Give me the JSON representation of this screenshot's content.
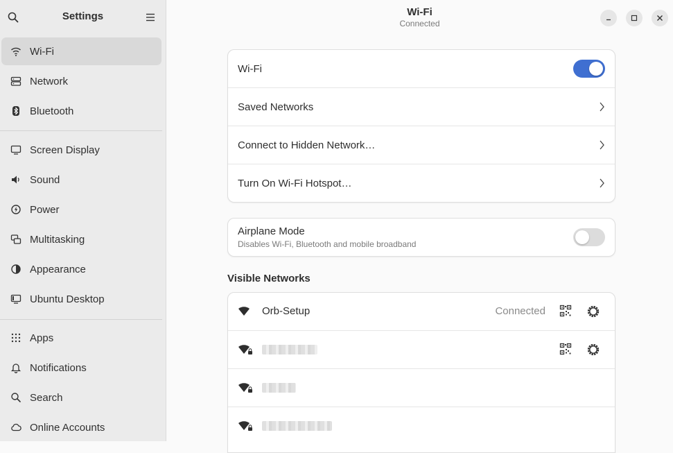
{
  "sidebar": {
    "title": "Settings",
    "items": [
      {
        "label": "Wi-Fi",
        "icon": "wifi-icon",
        "active": true
      },
      {
        "label": "Network",
        "icon": "network-icon"
      },
      {
        "label": "Bluetooth",
        "icon": "bluetooth-icon"
      },
      {
        "label": "Screen Display",
        "icon": "display-icon"
      },
      {
        "label": "Sound",
        "icon": "speaker-icon"
      },
      {
        "label": "Power",
        "icon": "power-icon"
      },
      {
        "label": "Multitasking",
        "icon": "multitasking-icon"
      },
      {
        "label": "Appearance",
        "icon": "appearance-icon"
      },
      {
        "label": "Ubuntu Desktop",
        "icon": "desktop-icon"
      },
      {
        "label": "Apps",
        "icon": "apps-grid-icon"
      },
      {
        "label": "Notifications",
        "icon": "bell-icon"
      },
      {
        "label": "Search",
        "icon": "search-icon"
      },
      {
        "label": "Online Accounts",
        "icon": "cloud-icon"
      }
    ]
  },
  "header": {
    "title": "Wi-Fi",
    "subtitle": "Connected"
  },
  "wifi_card": {
    "wifi_label": "Wi-Fi",
    "wifi_enabled": true,
    "saved_networks": "Saved Networks",
    "hidden_network": "Connect to Hidden Network…",
    "hotspot": "Turn On Wi-Fi Hotspot…"
  },
  "airplane": {
    "label": "Airplane Mode",
    "description": "Disables Wi-Fi, Bluetooth and mobile broadband",
    "enabled": false
  },
  "visible_networks": {
    "title": "Visible Networks",
    "networks": [
      {
        "name": "Orb-Setup",
        "status": "Connected",
        "secured": false
      },
      {
        "name": "",
        "status": "",
        "secured": true
      },
      {
        "name": "",
        "status": "",
        "secured": true
      },
      {
        "name": "",
        "status": "",
        "secured": true
      }
    ]
  },
  "colors": {
    "accent": "#3f6fd1",
    "sidebar_bg": "#ebebeb",
    "content_bg": "#fafafa"
  }
}
